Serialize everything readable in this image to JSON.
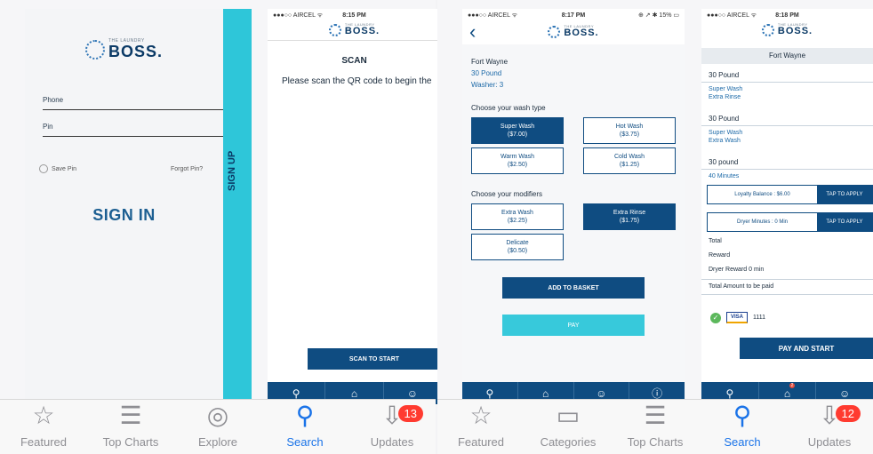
{
  "brand": {
    "small": "THE LAUNDRY",
    "big": "BOSS."
  },
  "signin": {
    "phone_label": "Phone",
    "pin_label": "Pin",
    "save_pin": "Save Pin",
    "forgot_pin": "Forgot Pin?",
    "signin_button": "SIGN IN",
    "signup_label": "SIGN UP"
  },
  "scan": {
    "status_left": "●●●○○ AIRCEL ᯤ",
    "status_time": "8:15 PM",
    "title": "SCAN",
    "instruction": "Please scan the QR code to begin the",
    "button": "SCAN TO START"
  },
  "wash": {
    "status_left": "●●●○○ AIRCEL ᯤ",
    "status_time": "8:17 PM",
    "status_right": "⊕ ↗ ✱ 15% ▭",
    "back": "‹",
    "location": "Fort Wayne",
    "load": "30 Pound",
    "washer": "Washer: 3",
    "wash_type_heading": "Choose your wash type",
    "wash_types": [
      {
        "name": "Super Wash",
        "price": "($7.00)",
        "selected": true
      },
      {
        "name": "Hot Wash",
        "price": "($3.75)",
        "selected": false
      },
      {
        "name": "Warm Wash",
        "price": "($2.50)",
        "selected": false
      },
      {
        "name": "Cold Wash",
        "price": "($1.25)",
        "selected": false
      }
    ],
    "modifiers_heading": "Choose your modifiers",
    "modifiers": [
      {
        "name": "Extra Wash",
        "price": "($2.25)",
        "selected": false
      },
      {
        "name": "Extra Rinse",
        "price": "($1.75)",
        "selected": true
      },
      {
        "name": "Delicate",
        "price": "($0.50)",
        "selected": false
      }
    ],
    "add_button": "ADD TO BASKET",
    "pay_button": "PAY"
  },
  "basket": {
    "status_left": "●●●○○ AIRCEL ᯤ",
    "status_time": "8:18 PM",
    "header": "Fort Wayne",
    "item1_title": "30 Pound",
    "item1_lines": [
      "Super Wash",
      "Extra Rinse"
    ],
    "item2_title": "30 Pound",
    "item2_lines": [
      "Super Wash",
      "Extra Wash"
    ],
    "item3_title": "30 pound",
    "item3_minutes": "40 Minutes",
    "loyalty_balance": "Loyalty Balance : $6.00",
    "loyalty_apply": "TAP TO APPLY",
    "dryer_minutes": "Dryer Minutes : 0 Min",
    "dryer_apply": "TAP TO APPLY",
    "total": "Total",
    "reward": "Reward",
    "dryer_reward": "Dryer Reward 0 min",
    "total_paid": "Total Amount to be paid",
    "card_brand": "VISA",
    "card_last4": "1111",
    "pay_start": "PAY AND START",
    "basket_badge": "2"
  },
  "store_left": {
    "items": [
      {
        "label": "Featured",
        "icon": "☆"
      },
      {
        "label": "Top Charts",
        "icon": "☰"
      },
      {
        "label": "Explore",
        "icon": "◎"
      },
      {
        "label": "Search",
        "icon": "⚲"
      },
      {
        "label": "Updates",
        "icon": "⇩"
      }
    ],
    "badge": "13"
  },
  "store_right": {
    "items": [
      {
        "label": "Featured",
        "icon": "☆"
      },
      {
        "label": "Categories",
        "icon": "▭"
      },
      {
        "label": "Top Charts",
        "icon": "☰"
      },
      {
        "label": "Search",
        "icon": "⚲"
      },
      {
        "label": "Updates",
        "icon": "⇩"
      }
    ],
    "badge": "12"
  },
  "colors": {
    "navy": "#0f4c81",
    "teal": "#37c9db",
    "accent": "#1a73e8",
    "badge": "#ff3b30"
  }
}
